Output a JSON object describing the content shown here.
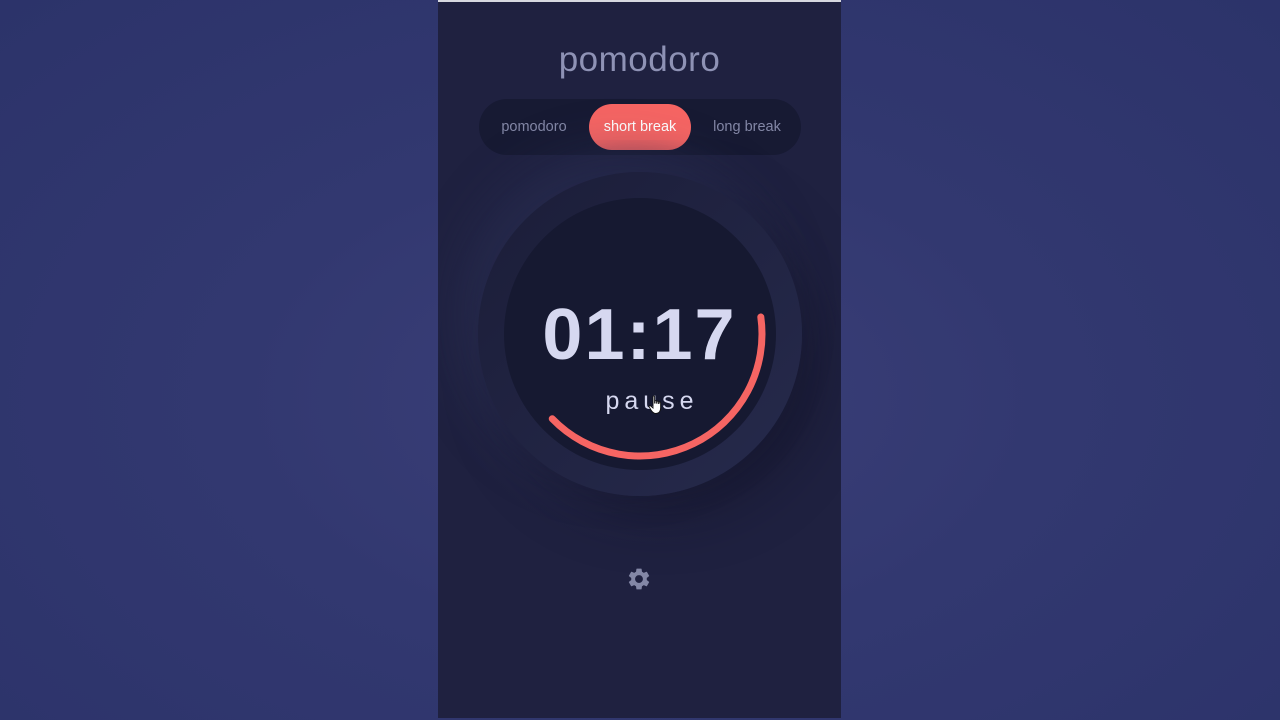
{
  "app": {
    "title": "pomodoro"
  },
  "tabs": [
    {
      "label": "pomodoro",
      "active": false
    },
    {
      "label": "short break",
      "active": true
    },
    {
      "label": "long break",
      "active": false
    }
  ],
  "timer": {
    "time": "01:17",
    "action_label": "pause",
    "progress": 0.4
  },
  "settings": {
    "icon": "gear-icon"
  },
  "colors": {
    "accent": "#f66563",
    "panel_bg": "#1f2140",
    "text_muted": "#8e92b5",
    "timer_text": "#d6d8f0"
  }
}
